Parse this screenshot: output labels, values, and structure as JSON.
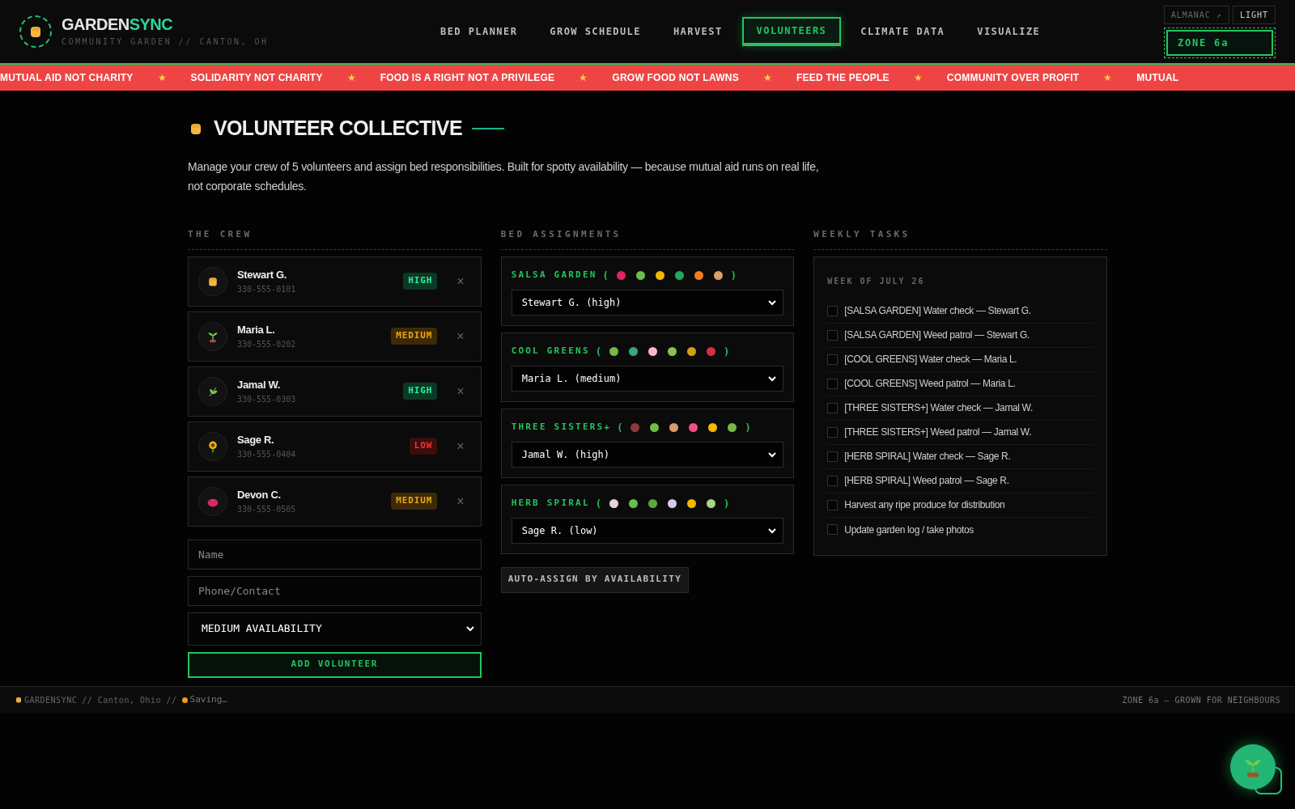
{
  "brand": {
    "name_a": "GARDEN",
    "name_b": "SYNC",
    "subtitle": "COMMUNITY GARDEN // CANTON, OH"
  },
  "nav": [
    {
      "label": "BED PLANNER",
      "selected": false
    },
    {
      "label": "GROW SCHEDULE",
      "selected": false
    },
    {
      "label": "HARVEST",
      "selected": false
    },
    {
      "label": "VOLUNTEERS",
      "selected": true
    },
    {
      "label": "CLIMATE DATA",
      "selected": false
    },
    {
      "label": "VISUALIZE",
      "selected": false
    }
  ],
  "header_right": {
    "almanac": "ALMANAC ↗",
    "theme": "LIGHT",
    "zone": "ZONE 6a"
  },
  "ticker": [
    {
      "text": "MUTUAL AID NOT CHARITY",
      "star": "★"
    },
    {
      "text": "SOLIDARITY NOT CHARITY",
      "star": "★"
    },
    {
      "text": "FOOD IS A RIGHT NOT A PRIVILEGE",
      "star": "★"
    },
    {
      "text": "GROW FOOD NOT LAWNS",
      "star": "★"
    },
    {
      "text": "FEED THE PEOPLE",
      "star": "★"
    },
    {
      "text": "COMMUNITY OVER PROFIT",
      "star": "★"
    },
    {
      "text": "MUTUAL"
    }
  ],
  "page": {
    "title": "VOLUNTEER COLLECTIVE",
    "intro": "Manage your crew of 5 volunteers and assign bed responsibilities. Built for spotty availability — because mutual aid runs on real life, not corporate schedules."
  },
  "crew": {
    "heading": "THE CREW",
    "members": [
      {
        "name": "Stewart G.",
        "phone": "330-555-0101",
        "badge": "HIGH",
        "color": "#0a3a26",
        "remove": "×"
      },
      {
        "name": "Maria L.",
        "phone": "330-555-0202",
        "badge": "MEDIUM",
        "color": "#3d2a05",
        "remove": "×"
      },
      {
        "name": "Jamal W.",
        "phone": "330-555-0303",
        "badge": "HIGH",
        "color": "#0a3a26",
        "remove": "×"
      },
      {
        "name": "Sage R.",
        "phone": "330-555-0404",
        "badge": "LOW",
        "color": "#3b0d0d",
        "remove": "×"
      },
      {
        "name": "Devon C.",
        "phone": "330-555-0505",
        "badge": "MEDIUM",
        "color": "#3d2a05",
        "remove": "×"
      }
    ],
    "form": {
      "name_placeholder": "Name",
      "contact_placeholder": "Phone/Contact",
      "availability": "MEDIUM AVAILABILITY",
      "submit": "ADD VOLUNTEER"
    }
  },
  "beds": {
    "heading": "BED ASSIGNMENTS",
    "items": [
      {
        "name": "SALSA GARDEN",
        "open": "(",
        "close": ")",
        "crops": [
          {
            "color": "#e0245e"
          },
          {
            "color": "#6abf4b"
          },
          {
            "color": "#f5b800"
          },
          {
            "color": "#1fa85c"
          },
          {
            "color": "#f47b20"
          },
          {
            "color": "#d9a066"
          }
        ],
        "assignee": "Stewart G. (high)"
      },
      {
        "name": "COOL GREENS",
        "open": "(",
        "close": ")",
        "crops": [
          {
            "color": "#7ab648"
          },
          {
            "color": "#3aa67a"
          },
          {
            "color": "#f7b6d8"
          },
          {
            "color": "#8cc152"
          },
          {
            "color": "#d4a017"
          },
          {
            "color": "#d62d4a"
          }
        ],
        "assignee": "Maria L. (medium)"
      },
      {
        "name": "THREE SISTERS+",
        "open": "(",
        "close": ")",
        "crops": [
          {
            "color": "#8b3a3a"
          },
          {
            "color": "#6fbf3f"
          },
          {
            "color": "#d99a6c"
          },
          {
            "color": "#f0508a"
          },
          {
            "color": "#f5b800"
          },
          {
            "color": "#78b84a"
          }
        ],
        "assignee": "Jamal W. (high)"
      },
      {
        "name": "HERB SPIRAL",
        "open": "(",
        "close": ")",
        "crops": [
          {
            "color": "#e8d4d4"
          },
          {
            "color": "#6abf4b"
          },
          {
            "color": "#5aa83c"
          },
          {
            "color": "#d8c8f0"
          },
          {
            "color": "#f5b800"
          },
          {
            "color": "#a6d785"
          }
        ],
        "assignee": "Sage R. (low)"
      }
    ],
    "auto_button": "AUTO-ASSIGN BY AVAILABILITY"
  },
  "tasks": {
    "heading": "WEEKLY TASKS",
    "week": "WEEK OF JULY 26",
    "items": [
      {
        "text": "[SALSA GARDEN] Water check — Stewart G.",
        "checked": false
      },
      {
        "text": "[SALSA GARDEN] Weed patrol — Stewart G.",
        "checked": false
      },
      {
        "text": "[COOL GREENS] Water check — Maria L.",
        "checked": false
      },
      {
        "text": "[COOL GREENS] Weed patrol — Maria L.",
        "checked": false
      },
      {
        "text": "[THREE SISTERS+] Water check — Jamal W.",
        "checked": false
      },
      {
        "text": "[THREE SISTERS+] Weed patrol — Jamal W.",
        "checked": false
      },
      {
        "text": "[HERB SPIRAL] Water check — Sage R.",
        "checked": false
      },
      {
        "text": "[HERB SPIRAL] Weed patrol — Sage R.",
        "checked": false
      },
      {
        "text": "Harvest any ripe produce for distribution",
        "checked": false
      },
      {
        "text": "Update garden log / take photos",
        "checked": false
      }
    ]
  },
  "footer": {
    "brand": "GARDENSYNC",
    "location": "// Canton, Ohio //",
    "status": "Saving…",
    "right": "ZONE 6a — GROWN FOR NEIGHBOURS"
  }
}
